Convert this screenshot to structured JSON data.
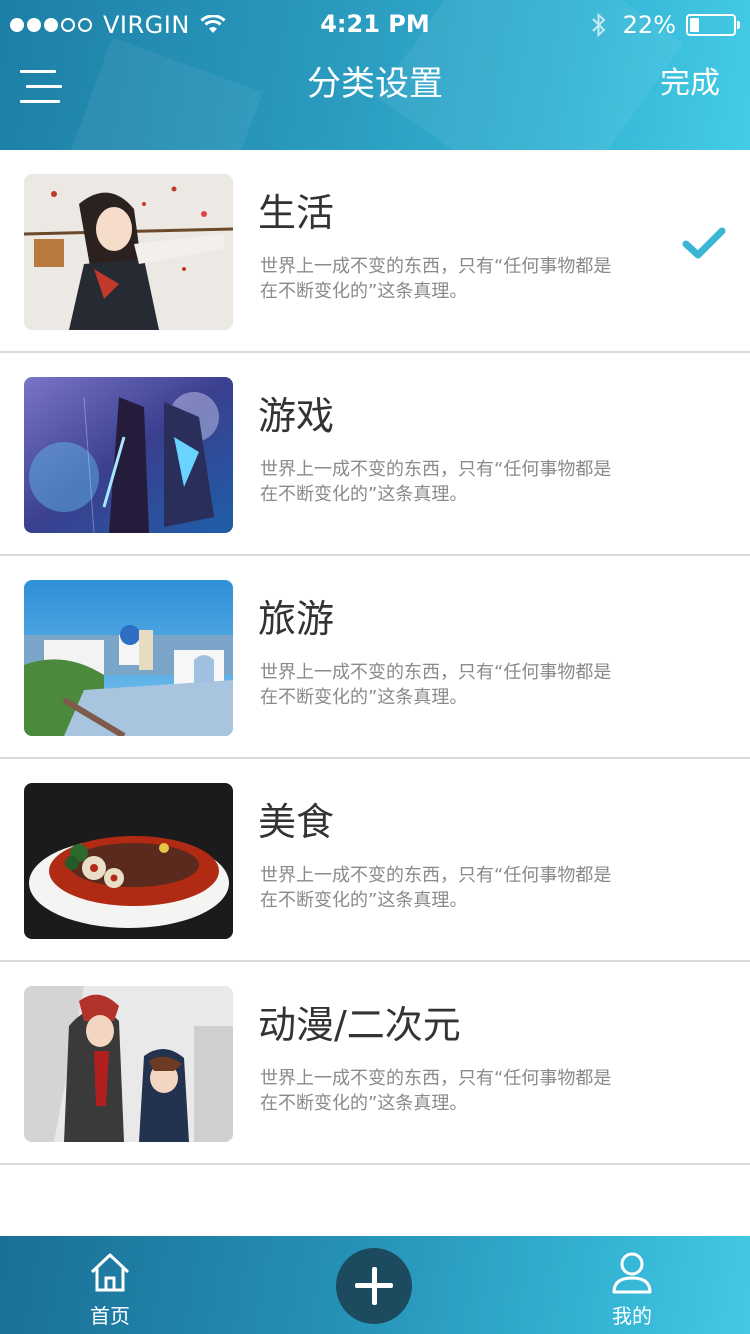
{
  "status_bar": {
    "carrier": "VIRGIN",
    "time": "4:21 PM",
    "battery": "22%",
    "battery_level": 0.22
  },
  "nav": {
    "title": "分类设置",
    "done_label": "完成"
  },
  "categories": [
    {
      "title": "生活",
      "description": "世界上一成不变的东西，只有“任何事物都是在不断变化的”这条真理。",
      "selected": true,
      "image": "anime-girl-archer"
    },
    {
      "title": "游戏",
      "description": "世界上一成不变的东西，只有“任何事物都是在不断变化的”这条真理。",
      "selected": false,
      "image": "game-warriors-battle"
    },
    {
      "title": "旅游",
      "description": "世界上一成不变的东西，只有“任何事物都是在不断变化的”这条真理。",
      "selected": false,
      "image": "seaside-village"
    },
    {
      "title": "美食",
      "description": "世界上一成不变的东西，只有“任何事物都是在不断变化的”这条真理。",
      "selected": false,
      "image": "spicy-dish-bowl"
    },
    {
      "title": "动漫/二次元",
      "description": "世界上一成不变的东西，只有“任何事物都是在不断变化的”这条真理。",
      "selected": false,
      "image": "anime-group-characters"
    }
  ],
  "tab_bar": {
    "home_label": "首页",
    "profile_label": "我的",
    "add_icon": "plus-icon"
  },
  "colors": {
    "accent": "#3ab5d6",
    "header_start": "#1d7fa6",
    "header_end": "#44cce6",
    "add_button": "#1c4a5e"
  }
}
